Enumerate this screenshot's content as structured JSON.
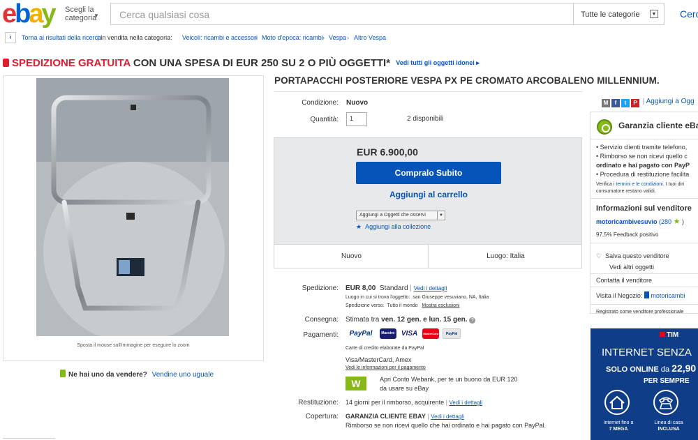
{
  "header": {
    "logo": [
      "e",
      "b",
      "a",
      "y"
    ],
    "category_button": [
      "Scegli la",
      "categoria"
    ],
    "search_placeholder": "Cerca qualsiasi cosa",
    "category_select": "Tutte le categorie",
    "search_button": "Cerca"
  },
  "breadcrumb": {
    "back": "Torna ai risultati della ricerca",
    "listed_in": "In vendita nella categoria:",
    "items": [
      "Veicoli: ricambi e accessori",
      "Moto d'epoca: ricambi",
      "Vespa",
      "Altro Vespa"
    ]
  },
  "promo": {
    "free_shipping": "SPEDIZIONE GRATUITA",
    "rest": "CON UNA SPESA DI EUR 250 SU 2 O PIÙ OGGETTI*",
    "link": "Vedi tutti gli oggetti idonei"
  },
  "gallery": {
    "zoom_caption": "Sposta il mouse sull'immagine per eseguire lo zoom",
    "sell_question": "Ne hai uno da vendere?",
    "sell_link": "Vendine uno uguale"
  },
  "item": {
    "title": "PORTAPACCHI POSTERIORE VESPA PX PE CROMATO ARCOBALENO MILLENNIUM.",
    "condition_label": "Condizione:",
    "condition_value": "Nuovo",
    "quantity_label": "Quantità:",
    "quantity_value": "1",
    "available": "2 disponibili",
    "price": "EUR 6.900,00",
    "buy_now": "Compralo Subito",
    "add_to_cart": "Aggiungi al carrello",
    "watch_select": "Aggiungi a Oggetti che osservi",
    "add_collection": "Aggiungi alla collezione",
    "cond_bar_left": "Nuovo",
    "cond_bar_right": "Luogo: Italia"
  },
  "details": {
    "shipping_label": "Spedizione:",
    "shipping_cost": "EUR 8,00",
    "shipping_type": "Standard",
    "see_details": "Vedi i dettagli",
    "item_location_label": "Luogo in cui si trova l'oggetto:",
    "item_location": "san Giuseppe vesuviano, NA, Italia",
    "ships_to_label": "Spedizione verso:",
    "ships_to": "Tutto il mondo",
    "show_exclusions": "Mostra esclusioni",
    "delivery_label": "Consegna:",
    "delivery_prefix": "Stimata tra",
    "delivery_dates": "ven. 12 gen. e lun. 15 gen.",
    "payments_label": "Pagamenti:",
    "payment_logos": [
      "PayPal",
      "Maestro",
      "VISA",
      "MasterCard",
      "PayPal"
    ],
    "cards_note": "Carte di credito elaborate da PayPal",
    "cards": "Visa/MasterCard, Amex",
    "payment_info_link": "Vedi le informazioni per il pagamento",
    "webank_badge": "W",
    "webank_offer_1": "Apri Conto Webank, per te un buono da EUR 120",
    "webank_offer_2": "da usare su eBay",
    "returns_label": "Restituzione:",
    "returns_value": "14 giorni per il rimborso, acquirente",
    "coverage_label": "Copertura:",
    "coverage_title": "GARANZIA CLIENTE EBAY",
    "coverage_text": "Rimborso se non ricevi quello che hai ordinato e hai pagato con PayPal."
  },
  "right": {
    "share_add": "Aggiungi a Ogg",
    "share_icons": [
      "M",
      "f",
      "t",
      "P"
    ],
    "guarantee_title": "Garanzia cliente eBay",
    "guarantee_points": [
      "• Servizio clienti tramite telefono,",
      "• Rimborso se non ricevi quello c",
      "  ordinato e hai pagato con PayP",
      "• Procedura di restituzione facilita"
    ],
    "terms_1_a": "Verifica i",
    "terms_1_link": "termini e le condizioni",
    "terms_1_b": ". I tuoi diri",
    "terms_2": "consumatore restano validi.",
    "seller_info_title": "Informazioni sul venditore",
    "seller_name": "motoricambivesuvio",
    "seller_score": "(280",
    "seller_score_close": ")",
    "feedback": "97,5% Feedback positivo",
    "save_seller": "Salva questo venditore",
    "other_items": "Vedi altri oggetti",
    "contact": "Contatta il venditore",
    "visit_store_label": "Visita il Negozio:",
    "store_name": "motoricambi",
    "registered": "Registrato come venditore professionale"
  },
  "ad": {
    "brand": "TIM",
    "line1": "INTERNET SENZA",
    "line2_a": "SOLO ONLINE",
    "line2_b": "da",
    "line2_c": "22,90",
    "line3": "PER SEMPRE",
    "caption1_a": "Internet fino a",
    "caption1_b": "7 MEGA",
    "caption2_a": "Linea di casa",
    "caption2_b": "INCLUSA"
  }
}
